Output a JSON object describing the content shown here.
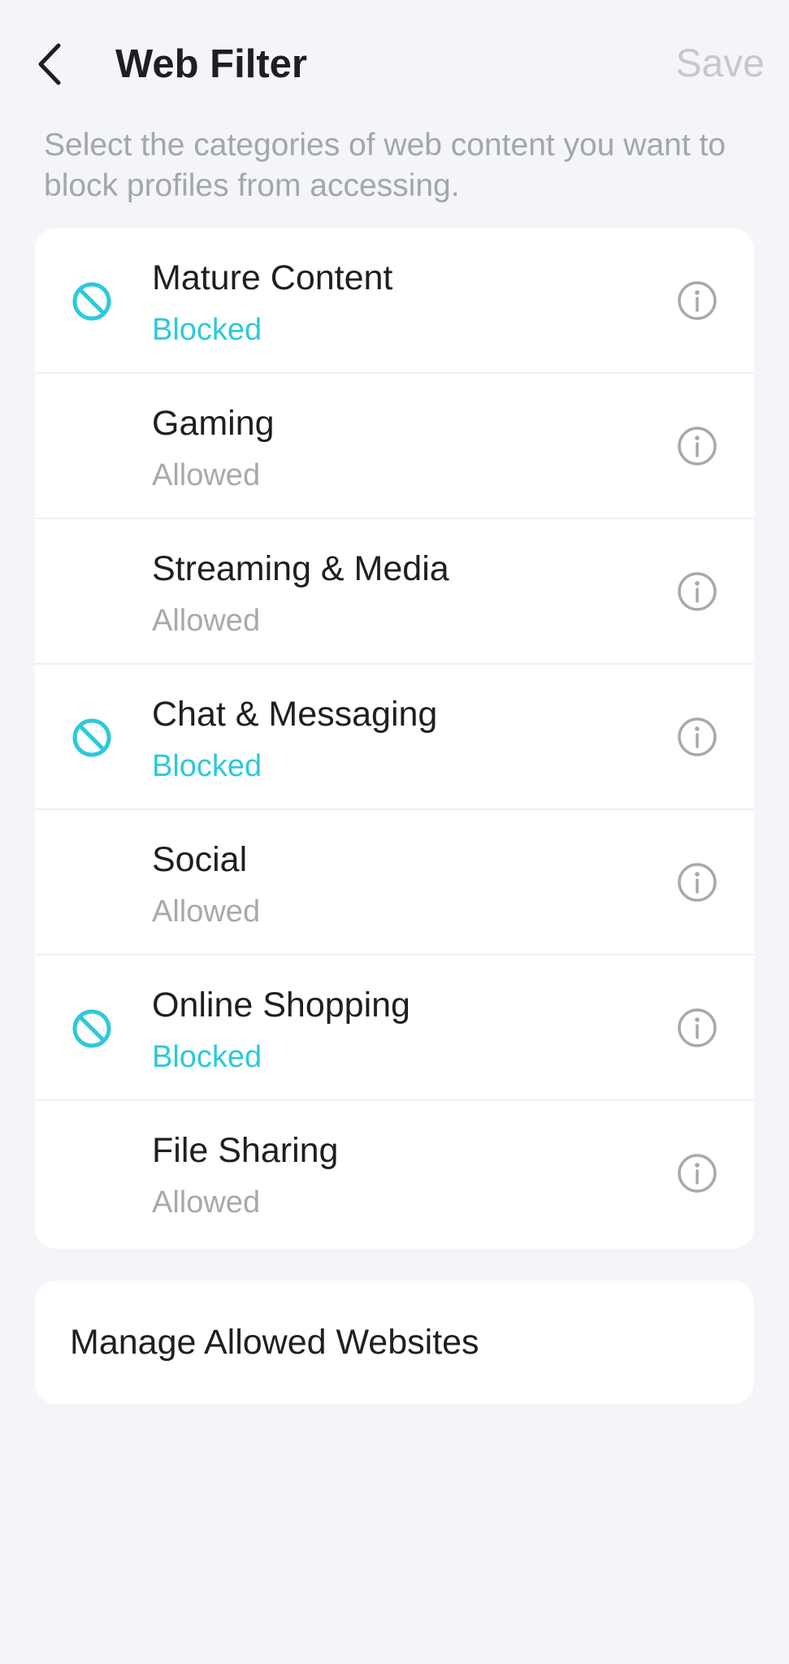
{
  "header": {
    "title": "Web Filter",
    "save_label": "Save"
  },
  "description": "Select the categories of web content you want to block profiles from accessing.",
  "categories": [
    {
      "name": "Mature Content",
      "status": "Blocked"
    },
    {
      "name": "Gaming",
      "status": "Allowed"
    },
    {
      "name": "Streaming & Media",
      "status": "Allowed"
    },
    {
      "name": "Chat & Messaging",
      "status": "Blocked"
    },
    {
      "name": "Social",
      "status": "Allowed"
    },
    {
      "name": "Online Shopping",
      "status": "Blocked"
    },
    {
      "name": "File Sharing",
      "status": "Allowed"
    }
  ],
  "manage": {
    "label": "Manage Allowed Websites"
  },
  "icons": {
    "back": "chevron-left-icon",
    "blocked": "block-icon",
    "info": "info-icon"
  },
  "colors": {
    "accent": "#2ec8dc",
    "background": "#f4f5f9",
    "muted": "#a7a9ad",
    "save_disabled": "#c6c8cd"
  }
}
